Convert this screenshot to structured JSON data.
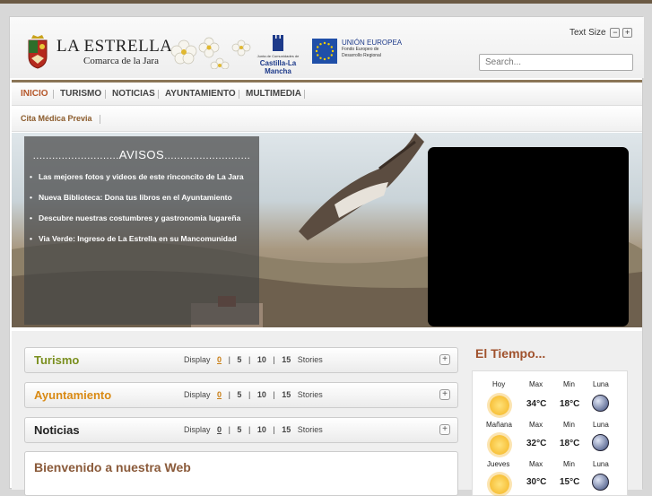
{
  "header": {
    "site_title": "LA ESTRELLA",
    "site_subtitle": "Comarca de la Jara",
    "clm_small": "Junta de Comunidades de",
    "clm_name": "Castilla-La Mancha",
    "eu_title": "UNIÓN EUROPEA",
    "eu_sub1": "Fondo Europeo de",
    "eu_sub2": "Desarrollo Regional",
    "text_size_label": "Text Size",
    "text_size_minus": "−",
    "text_size_plus": "+",
    "search_placeholder": "Search..."
  },
  "nav": {
    "items": [
      "INICIO",
      "TURISMO",
      "NOTICIAS",
      "AYUNTAMIENTO",
      "MULTIMEDIA"
    ],
    "active": "INICIO"
  },
  "subnav": {
    "item": "Cita Médica Previa"
  },
  "avisos": {
    "title": "AVISOS",
    "items": [
      "Las mejores fotos y videos de este rinconcito de La Jara",
      "Nueva Biblioteca: Dona tus libros en el Ayuntamiento",
      "Descubre nuestras costumbres y gastronomia lugareña",
      "Via Verde: Ingreso de La Estrella en su Mancomunidad"
    ]
  },
  "modules": [
    {
      "title": "Turismo",
      "color": "#7a8f1e"
    },
    {
      "title": "Ayuntamiento",
      "color": "#d98a14"
    },
    {
      "title": "Noticias",
      "color": "#222222"
    }
  ],
  "display": {
    "label": "Display",
    "options": [
      "0",
      "5",
      "10",
      "15"
    ],
    "selected": "0",
    "suffix": "Stories",
    "sep": "|"
  },
  "welcome_title": "Bienvenido a nuestra Web",
  "weather": {
    "title": "El Tiempo...",
    "col_max": "Max",
    "col_min": "Min",
    "col_moon": "Luna",
    "days": [
      {
        "day": "Hoy",
        "max": "34°C",
        "min": "18°C"
      },
      {
        "day": "Mañana",
        "max": "32°C",
        "min": "18°C"
      },
      {
        "day": "Jueves",
        "max": "30°C",
        "min": "15°C"
      }
    ]
  }
}
